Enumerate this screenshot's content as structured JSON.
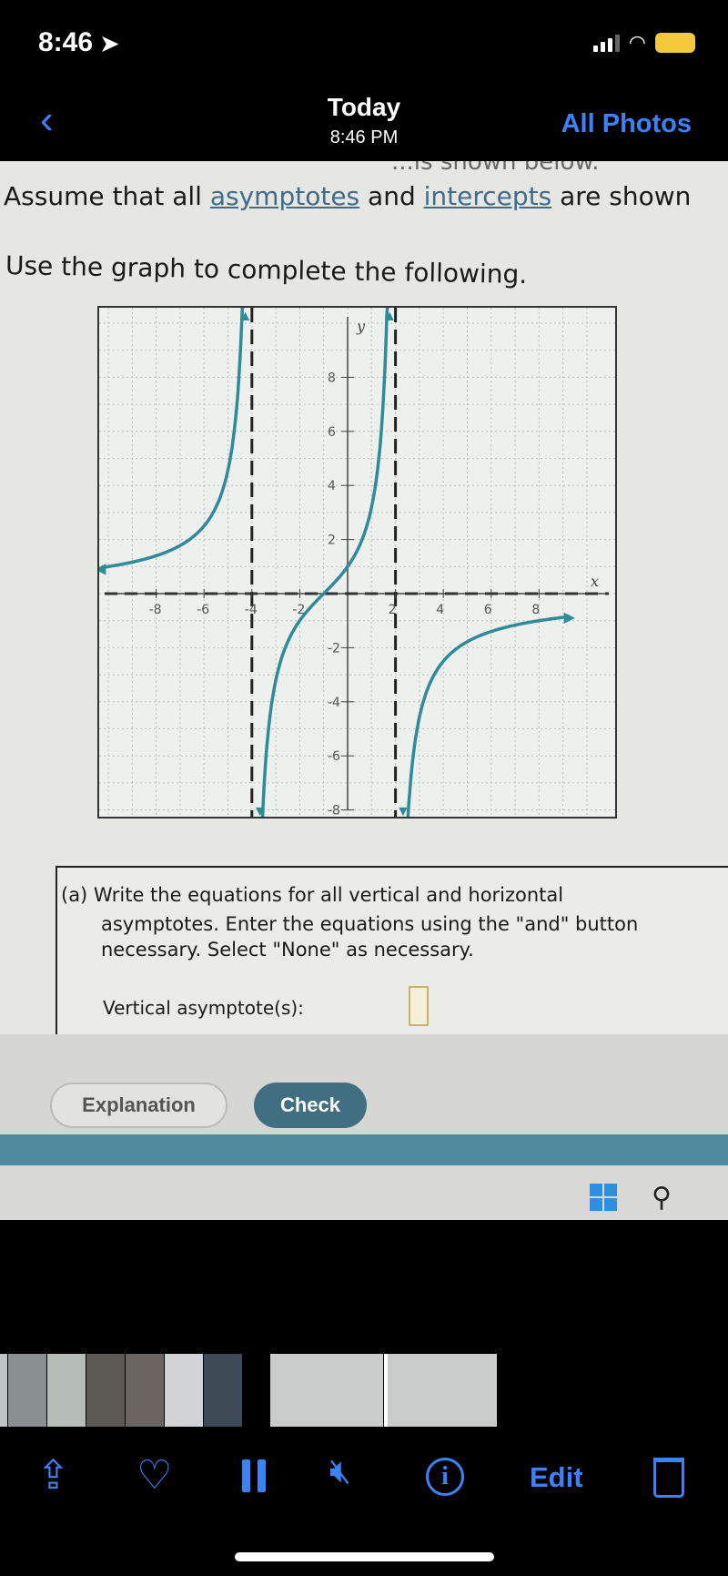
{
  "status_bar": {
    "time": "8:46",
    "location_icon": "location-arrow-icon",
    "signal_icon": "cellular-signal-icon",
    "wifi_icon": "wifi-icon",
    "battery_icon": "battery-charging-icon"
  },
  "nav": {
    "back_icon": "chevron-left-icon",
    "title": "Today",
    "subtitle": "8:46 PM",
    "all_photos": "All Photos"
  },
  "photo": {
    "cut_line": "...is shown below.",
    "line1_pre": "Assume that all ",
    "line1_link1": "asymptotes",
    "line1_mid": " and ",
    "line1_link2": "intercepts",
    "line1_post": " are shown",
    "line2": "Use the graph to complete the following.",
    "chart_data": {
      "type": "line",
      "xlabel": "x",
      "ylabel": "y",
      "xlim": [
        -10,
        10
      ],
      "ylim": [
        -10,
        10
      ],
      "x_ticks": [
        "-8",
        "-6",
        "-4",
        "-2",
        "2",
        "4",
        "6",
        "8"
      ],
      "y_ticks": [
        "8",
        "6",
        "4",
        "2",
        "-2",
        "-4",
        "-6",
        "-8"
      ],
      "grid": true,
      "curve_color": "#2f8a99",
      "vertical_asymptotes": [
        -4,
        2
      ],
      "horizontal_asymptote": 0,
      "x_intercept": -1,
      "y_intercept": 1,
      "branches": [
        {
          "x": [
            -10,
            -9,
            -8,
            -7,
            -6,
            -5,
            -4.6,
            -4.3
          ],
          "y": [
            1.0,
            1.14,
            1.4,
            1.87,
            2.8,
            5.71,
            10.5,
            23
          ]
        },
        {
          "x": [
            -3.7,
            -3.5,
            -3,
            -2,
            -1,
            0,
            1,
            1.5,
            1.7
          ],
          "y": [
            -11.2,
            -6.4,
            -3.2,
            -1,
            0,
            1,
            3.2,
            6.4,
            10
          ]
        },
        {
          "x": [
            2.3,
            2.5,
            3,
            4,
            5,
            6,
            7,
            8,
            9.3
          ],
          "y": [
            -11,
            -6.8,
            -4.6,
            -2.5,
            -1.8,
            -1.4,
            -1.2,
            -1,
            -0.85
          ]
        }
      ]
    },
    "part_a": {
      "line1": "(a) Write the equations for all vertical and horizontal",
      "line2": "asymptotes. Enter the equations using the \"and\" button",
      "line3": "necessary. Select \"None\" as necessary.",
      "vertical_label": "Vertical asymptote(s):",
      "vertical_value": ""
    },
    "buttons": {
      "explanation": "Explanation",
      "check": "Check"
    }
  },
  "toolbar": {
    "share_icon": "share-icon",
    "favorite_icon": "heart-icon",
    "pause_icon": "pause-icon",
    "mute_icon": "speaker-muted-icon",
    "info_icon": "info-icon",
    "edit": "Edit",
    "delete_icon": "trash-icon"
  },
  "colors": {
    "accent": "#3b82f6",
    "teal": "#4e8a9c",
    "curve": "#2f8a99"
  }
}
